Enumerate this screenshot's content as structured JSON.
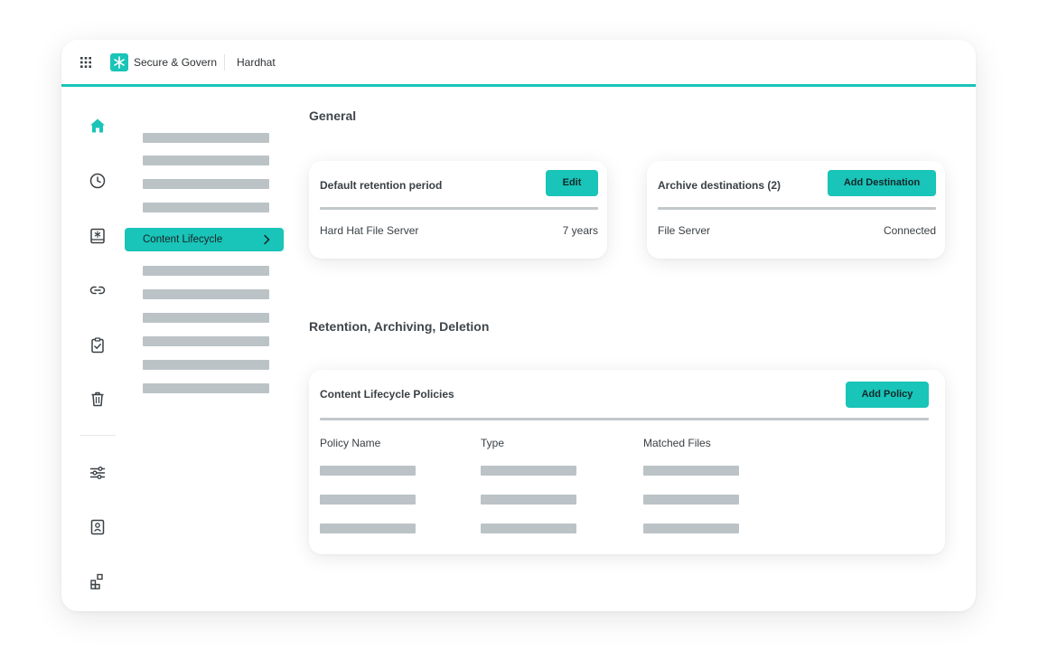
{
  "header": {
    "brand_name": "Secure & Govern",
    "org_name": "Hardhat"
  },
  "rail": {
    "icons": [
      "home-icon",
      "history-icon",
      "repository-icon",
      "link-icon",
      "clipboard-check-icon",
      "trash-icon",
      "sliders-icon",
      "document-user-icon",
      "apps-icon"
    ]
  },
  "nav": {
    "active_label": "Content Lifecycle"
  },
  "general": {
    "title": "General",
    "retention_card": {
      "title": "Default retention period",
      "edit_label": "Edit",
      "row_label": "Hard Hat File Server",
      "row_value": "7 years"
    },
    "archive_card": {
      "title": "Archive destinations (2)",
      "add_label": "Add Destination",
      "row_label": "File Server",
      "row_value": "Connected"
    }
  },
  "retention": {
    "title": "Retention, Archiving, Deletion",
    "policies_card": {
      "title": "Content Lifecycle Policies",
      "add_label": "Add Policy",
      "columns": [
        "Policy Name",
        "Type",
        "Matched Files"
      ]
    }
  },
  "colors": {
    "accent": "#19c4b8",
    "placeholder": "#bcc3c7",
    "text": "#3a4045"
  }
}
